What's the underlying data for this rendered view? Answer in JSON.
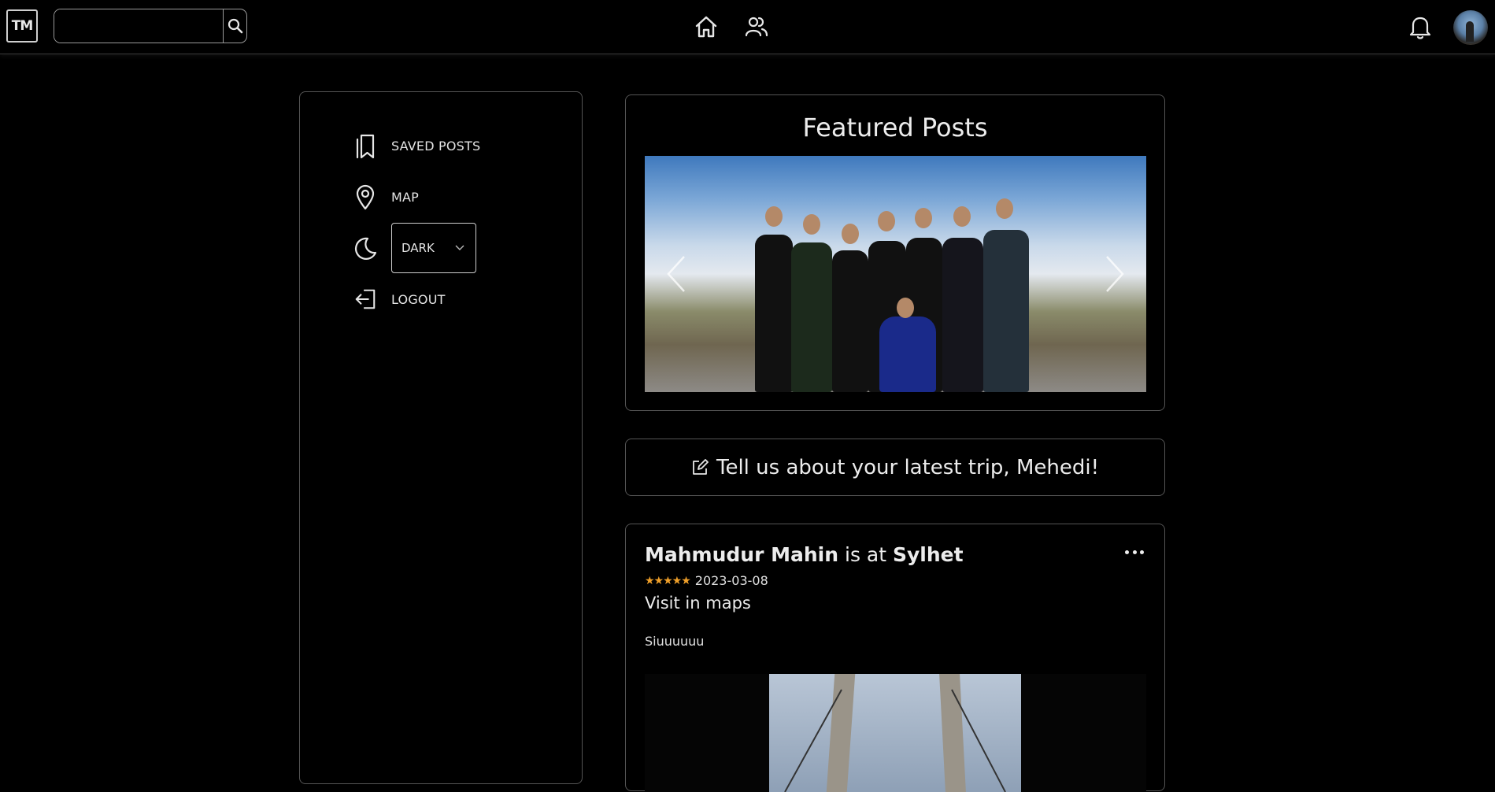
{
  "topbar": {
    "logo_text": "TM",
    "search": {
      "value": "",
      "placeholder": ""
    },
    "nav": [
      "home-icon",
      "people-icon"
    ],
    "right": [
      "bell-icon",
      "avatar"
    ]
  },
  "sidebar": {
    "items": [
      {
        "label": "SAVED POSTS",
        "icon": "bookmark-icon"
      },
      {
        "label": "MAP",
        "icon": "map-pin-icon"
      },
      {
        "label": "DARK",
        "icon": "moon-icon"
      },
      {
        "label": "LOGOUT",
        "icon": "logout-icon"
      }
    ]
  },
  "featured": {
    "title": "Featured Posts"
  },
  "composer": {
    "prompt": "Tell us about your latest trip, Mehedi!"
  },
  "post": {
    "author": "Mahmudur Mahin",
    "connector": "is at",
    "location": "Sylhet",
    "stars": "★★★★★",
    "date": "2023-03-08",
    "map_link": "Visit in maps",
    "caption": "Siuuuuuu"
  },
  "colors": {
    "background": "#000000",
    "border": "#555555",
    "star": "#f0a02a"
  }
}
